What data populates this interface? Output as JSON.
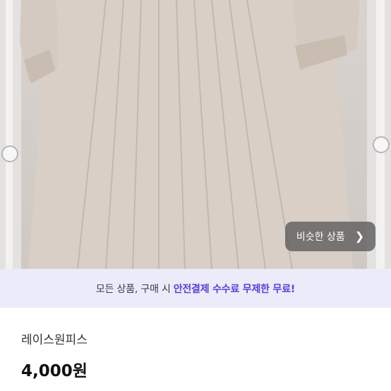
{
  "product_image": {
    "alt_icon": "product-photo",
    "similar_button": {
      "label": "비슷한 상품",
      "icon": "chevron-right-icon"
    }
  },
  "promo_banner": {
    "text_prefix": "모든 상품, 구매 시",
    "text_highlight": "안전결제 수수료 무제한 무료!",
    "highlight_color": "#5b3fd9",
    "background": "#ebebfa"
  },
  "product": {
    "title": "레이스원피스",
    "price": "4,000원"
  }
}
